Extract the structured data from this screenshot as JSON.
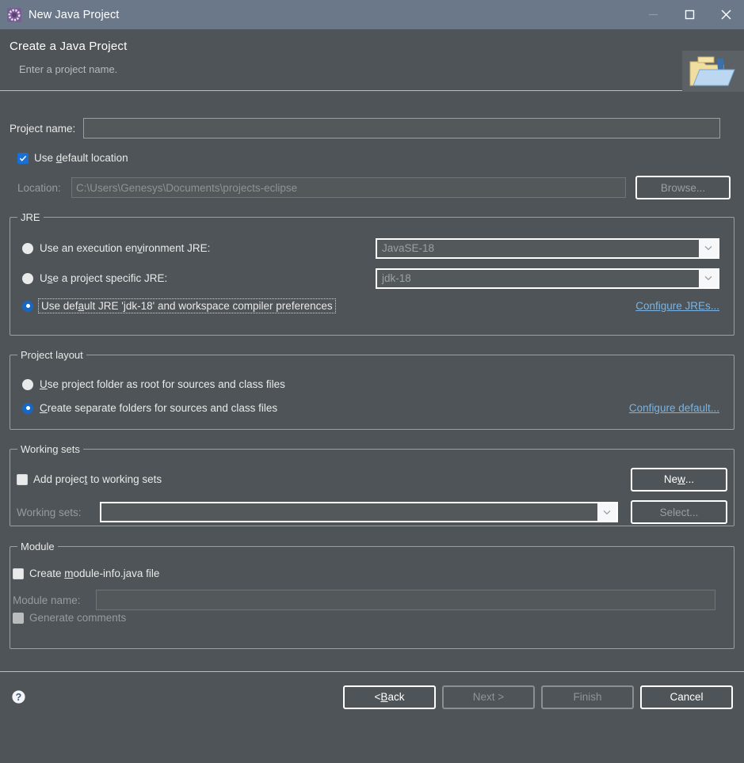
{
  "window": {
    "title": "New Java Project",
    "icon": "eclipse-wizard-icon",
    "controls": {
      "minimize": "—",
      "maximize": "□",
      "close": "✕"
    }
  },
  "header": {
    "title": "Create a Java Project",
    "subtitle": "Enter a project name.",
    "image": "java-project-folder-icon"
  },
  "project_name": {
    "label": "Project name:",
    "value": "",
    "placeholder": ""
  },
  "location": {
    "use_default_checkbox": {
      "label_pre": "Use ",
      "label_mnemonic": "d",
      "label_post": "efault location",
      "checked": true
    },
    "label": "Location:",
    "value": "C:\\Users\\Genesys\\Documents\\projects-eclipse",
    "browse_button": "Browse...",
    "browse_enabled": false
  },
  "jre": {
    "group_title": "JRE",
    "options": [
      {
        "label_pre": "Use an execution en",
        "label_mnemonic": "v",
        "label_post": "ironment JRE:",
        "selected": false,
        "combo_value": "JavaSE-18",
        "combo_enabled": false
      },
      {
        "label_pre": "U",
        "label_mnemonic": "s",
        "label_post": "e a project specific JRE:",
        "selected": false,
        "combo_value": "jdk-18",
        "combo_enabled": false
      },
      {
        "label_pre": "Use def",
        "label_mnemonic": "a",
        "label_post": "ult JRE 'jdk-18' and workspace compiler preferences",
        "selected": true,
        "focused": true
      }
    ],
    "configure_link": "Configure JREs..."
  },
  "project_layout": {
    "group_title": "Project layout",
    "options": [
      {
        "label_pre": "",
        "label_mnemonic": "U",
        "label_post": "se project folder as root for sources and class files",
        "selected": false
      },
      {
        "label_pre": "",
        "label_mnemonic": "C",
        "label_post": "reate separate folders for sources and class files",
        "selected": true
      }
    ],
    "configure_link": "Configure default..."
  },
  "working_sets": {
    "group_title": "Working sets",
    "add_checkbox": {
      "label_pre": "Add projec",
      "label_mnemonic": "t",
      "label_post": " to working sets",
      "checked": false
    },
    "new_button": {
      "pre": "Ne",
      "mnemonic": "w",
      "post": "...",
      "enabled": true
    },
    "label": "Working sets:",
    "combo_value": "",
    "combo_enabled": true,
    "select_button": "Select...",
    "select_enabled": false
  },
  "module": {
    "group_title": "Module",
    "create_checkbox": {
      "label_pre": "Create ",
      "label_mnemonic": "m",
      "label_post": "odule-info.java file",
      "checked": false,
      "enabled": true
    },
    "name_label": "Module name:",
    "name_value": "",
    "name_enabled": false,
    "generate_comments_checkbox": {
      "label": "Generate comments",
      "checked": false,
      "enabled": false
    }
  },
  "footer": {
    "help_icon": "help-question-icon",
    "buttons": [
      {
        "pre": "< ",
        "mnemonic": "B",
        "post": "ack",
        "name": "back",
        "enabled": true
      },
      {
        "pre": "Next >",
        "mnemonic": "",
        "post": "",
        "name": "next",
        "enabled": false
      },
      {
        "pre": "Finish",
        "mnemonic": "",
        "post": "",
        "name": "finish",
        "enabled": false
      },
      {
        "pre": "Cancel",
        "mnemonic": "",
        "post": "",
        "name": "cancel",
        "enabled": true
      }
    ]
  },
  "colors": {
    "titlebar": "#6a788a",
    "background": "#4e5457",
    "accent_blue": "#1668c4",
    "link_blue": "#7bb4e3",
    "border_light": "#9a9fa1"
  }
}
